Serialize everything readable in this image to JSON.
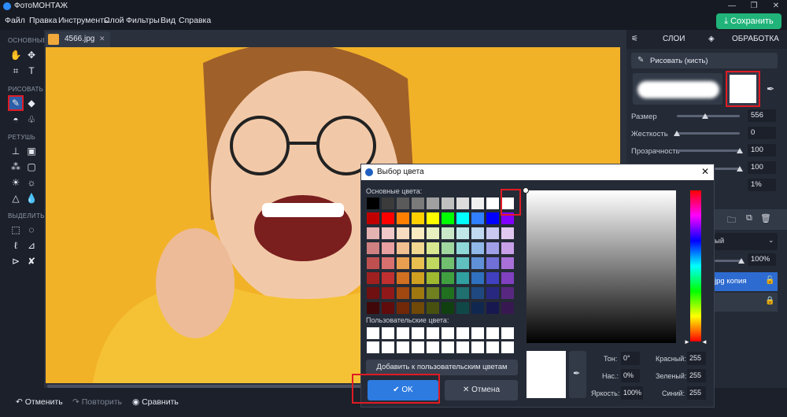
{
  "app": {
    "title": "ФотоМОНТАЖ",
    "save_label": "Сохранить"
  },
  "menu": [
    "Файл",
    "Правка",
    "Инструменты",
    "Слой",
    "Фильтры",
    "Вид",
    "Справка"
  ],
  "tools": {
    "sections": [
      "ОСНОВНЫЕ",
      "РИСОВАТЬ",
      "РЕТУШЬ",
      "ВЫДЕЛИТЬ"
    ]
  },
  "tab": {
    "filename": "4566.jpg"
  },
  "bottom": {
    "undo": "Отменить",
    "redo": "Повторить",
    "compare": "Сравнить"
  },
  "right_panel": {
    "tabs": [
      "СЛОИ",
      "ОБРАБОТКА"
    ],
    "brush_button": "Рисовать (кисть)",
    "brush_color": "#ffffff",
    "properties": [
      {
        "label": "Размер",
        "value": "556",
        "level": 0.45
      },
      {
        "label": "Жесткость",
        "value": "0",
        "level": 0.0
      },
      {
        "label": "Прозрачность",
        "value": "100",
        "level": 1.0
      },
      {
        "label": "",
        "value": "100",
        "level": 1.0
      },
      {
        "label": "",
        "value": "1%",
        "level": 0.02
      }
    ],
    "blend_mode_partial": "ый",
    "opacity": "100%",
    "layers": [
      "jpg копия"
    ]
  },
  "dialog": {
    "title": "Выбор цвета",
    "basic_label": "Основные цвета:",
    "custom_label": "Пользовательские цвета:",
    "add_custom": "Добавить к пользовательским цветам",
    "ok": "OK",
    "cancel": "Отмена",
    "fields": {
      "hue_label": "Тон:",
      "hue": "0°",
      "sat_label": "Нас.:",
      "sat": "0%",
      "bright_label": "Яркость:",
      "bright": "100%",
      "red_label": "Красный:",
      "red": "255",
      "green_label": "Зеленый:",
      "green": "255",
      "blue_label": "Синий:",
      "blue": "255"
    },
    "basic_colors": [
      [
        "#000000",
        "#3b3b3b",
        "#5a5a5a",
        "#7a7a7a",
        "#a0a0a0",
        "#c0c0c0",
        "#dcdcdc",
        "#f0f0f0",
        "#ffffff",
        "#ffffff"
      ],
      [
        "#c00000",
        "#ff0000",
        "#ff8000",
        "#ffd000",
        "#ffff00",
        "#00ff00",
        "#00ffff",
        "#3080ff",
        "#0000ff",
        "#8000ff"
      ],
      [
        "#e6b3b3",
        "#f0c8c8",
        "#f8dcc0",
        "#f8ecc0",
        "#e8f0c0",
        "#c8e8c8",
        "#c0e8e8",
        "#c0d8f0",
        "#c8c8f0",
        "#e0c8f0"
      ],
      [
        "#d08080",
        "#e8a0a0",
        "#f0c090",
        "#f0d890",
        "#d8e890",
        "#a0d8a0",
        "#90d8d8",
        "#90b8e8",
        "#a0a0e8",
        "#c8a0e8"
      ],
      [
        "#c05050",
        "#d87070",
        "#e8a050",
        "#e8c050",
        "#c0d860",
        "#70c070",
        "#60c0c0",
        "#6090d8",
        "#7070d8",
        "#a870d8"
      ],
      [
        "#a02020",
        "#c03030",
        "#d07020",
        "#d0a020",
        "#a0b830",
        "#40a040",
        "#30a0a0",
        "#3070c0",
        "#4040c0",
        "#8040c0"
      ],
      [
        "#701010",
        "#901818",
        "#a04810",
        "#a07810",
        "#708020",
        "#207020",
        "#207070",
        "#204880",
        "#282880",
        "#582880"
      ],
      [
        "#400808",
        "#600c0c",
        "#702808",
        "#704808",
        "#485010",
        "#104010",
        "#104848",
        "#102850",
        "#181850",
        "#381850"
      ]
    ]
  }
}
